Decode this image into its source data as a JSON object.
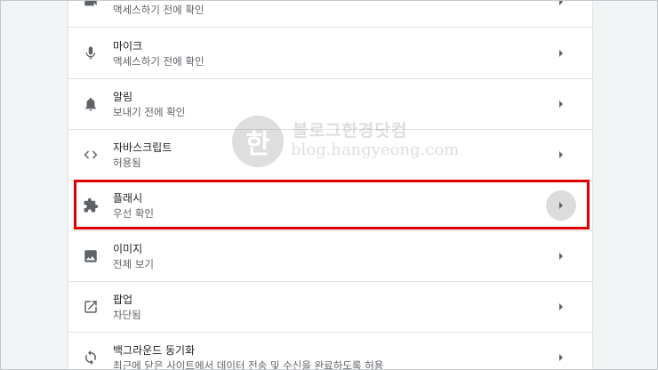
{
  "settings": {
    "rows": [
      {
        "id": "camera",
        "icon": "videocam-icon",
        "title": "",
        "subtitle": "액세스하기 전에 확인"
      },
      {
        "id": "microphone",
        "icon": "mic-icon",
        "title": "마이크",
        "subtitle": "액세스하기 전에 확인"
      },
      {
        "id": "notifications",
        "icon": "bell-icon",
        "title": "알림",
        "subtitle": "보내기 전에 확인"
      },
      {
        "id": "javascript",
        "icon": "code-icon",
        "title": "자바스크립트",
        "subtitle": "허용됨"
      },
      {
        "id": "flash",
        "icon": "puzzle-icon",
        "title": "플래시",
        "subtitle": "우선 확인",
        "highlighted": true
      },
      {
        "id": "images",
        "icon": "image-icon",
        "title": "이미지",
        "subtitle": "전체 보기"
      },
      {
        "id": "popups",
        "icon": "open-in-new-icon",
        "title": "팝업",
        "subtitle": "차단됨"
      },
      {
        "id": "background-sync",
        "icon": "sync-icon",
        "title": "백그라운드 동기화",
        "subtitle": "최근에 닫은 사이트에서 데이터 전송 및 수신을 완료하도록 허용"
      }
    ]
  },
  "watermark": {
    "seal_char": "한",
    "text_ko": "블로그한경닷컴",
    "text_en": "blog.hangyeong.com"
  },
  "colors": {
    "highlight_border": "#e00000",
    "icon": "#5f6368",
    "divider": "#e0e0e0"
  }
}
